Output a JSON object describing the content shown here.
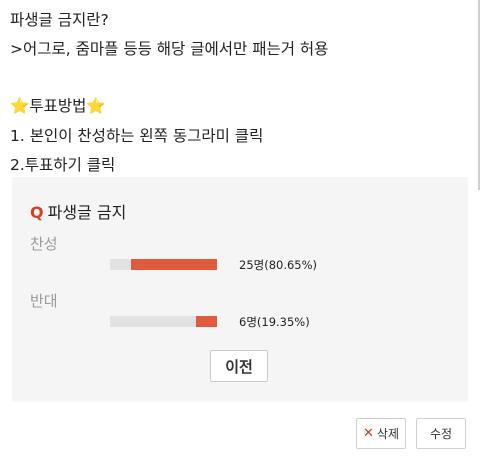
{
  "post": {
    "lines": [
      "파생글 금지란?",
      ">어그로, 줌마플 등등 해당 글에서만 패는거 허용",
      "",
      "투표방법",
      "1. 본인이 찬성하는 왼쪽 동그라미 클릭",
      "2.투표하기 클릭"
    ],
    "star_glyph": "⭐"
  },
  "poll": {
    "q_mark": "Q",
    "title": "파생글 금지",
    "options": [
      {
        "label": "찬성",
        "result": "25명(80.65%)",
        "percent": 80.65
      },
      {
        "label": "반대",
        "result": "6명(19.35%)",
        "percent": 19.35
      }
    ],
    "prev_label": "이전"
  },
  "actions": {
    "delete_icon": "✕",
    "delete_label": "삭제",
    "edit_label": "수정"
  },
  "colors": {
    "accent": "#e05a3e",
    "q_mark": "#d6402a",
    "poll_bg": "#f5f5f5"
  }
}
